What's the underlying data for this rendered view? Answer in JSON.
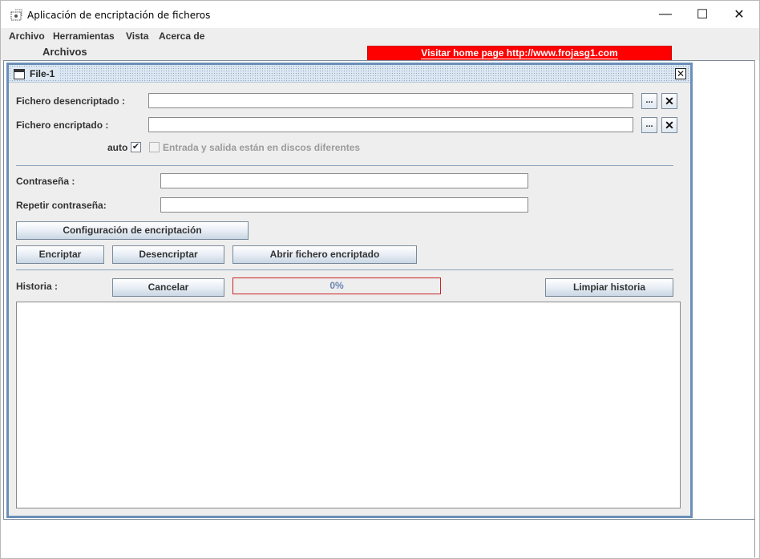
{
  "window": {
    "title": "Aplicación de encriptación de ficheros",
    "minimize": "—",
    "maximize": "☐",
    "close": "✕"
  },
  "menu": {
    "items": [
      "Archivo",
      "Herramientas",
      "Vista",
      "Acerca de"
    ]
  },
  "toolbar": {
    "section_label": "Archivos",
    "home_link": "Visitar home page http://www.frojasg1.com"
  },
  "internal_frame": {
    "title": "File-1",
    "close": "✕"
  },
  "form": {
    "decrypted_label": "Fichero desencriptado :",
    "decrypted_value": "",
    "encrypted_label": "Fichero encriptado :",
    "encrypted_value": "",
    "browse_label": "...",
    "clear_label": "✕",
    "auto_label": "auto",
    "auto_checked": true,
    "different_disks_label": "Entrada y salida están en discos diferentes",
    "different_disks_checked": false,
    "password_label": "Contraseña :",
    "password_value": "",
    "repeat_password_label": "Repetir contraseña:",
    "repeat_password_value": ""
  },
  "buttons": {
    "config": "Configuración de encriptación",
    "encrypt": "Encriptar",
    "decrypt": "Desencriptar",
    "open_encrypted": "Abrir fichero encriptado",
    "cancel": "Cancelar",
    "clear_history": "Limpiar historia"
  },
  "history": {
    "label": "Historia :",
    "progress_text": "0%",
    "progress_value": 0,
    "content": ""
  },
  "colors": {
    "home_link_bg": "#ff0000",
    "frame_border": "#6b8fb8",
    "progress_border": "#cc2222"
  }
}
